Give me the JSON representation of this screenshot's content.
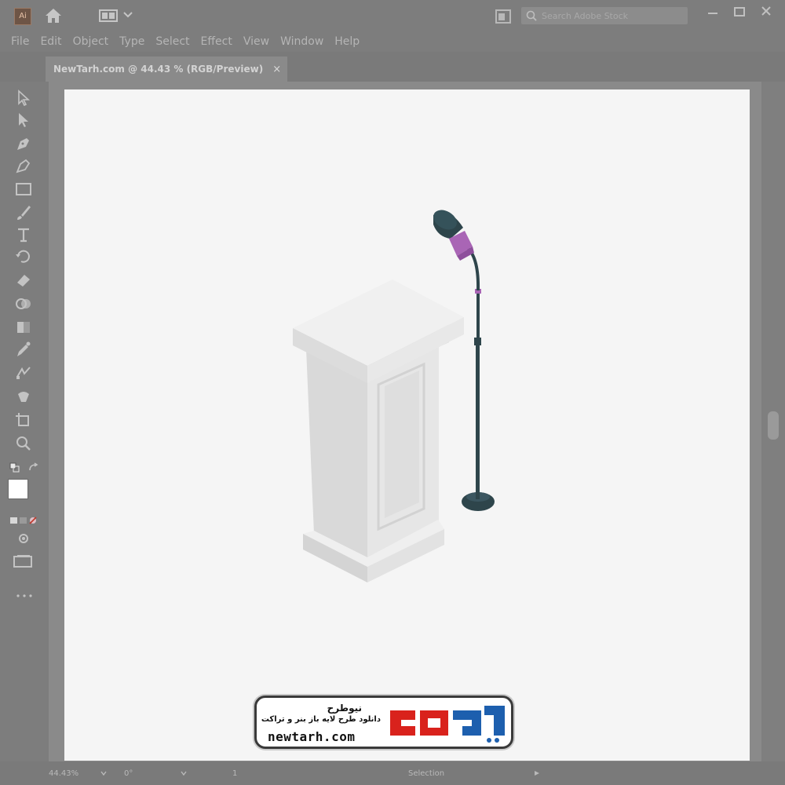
{
  "app": {
    "logo_text": "Ai",
    "search_placeholder": "Search Adobe Stock"
  },
  "menu": {
    "items": [
      "File",
      "Edit",
      "Object",
      "Type",
      "Select",
      "Effect",
      "View",
      "Window",
      "Help"
    ]
  },
  "document_tab": {
    "label": "NewTarh.com @ 44.43 % (RGB/Preview)",
    "close": "×"
  },
  "status": {
    "zoom": "44.43%",
    "rotate": "0°",
    "artboard": "1",
    "mode": "Selection"
  },
  "watermark": {
    "brand_fa": "نیوطرح",
    "tagline_fa": "دانلود طرح لایه باز بنر و تراکت",
    "url": "newtarh.com",
    "logo_text_fa": "نیوطرح"
  },
  "colors": {
    "chrome": "#7d7d7d",
    "canvas": "#8a8a8a",
    "artboard": "#f5f5f5",
    "mic_body": "#2e454b",
    "mic_accent": "#a965b5",
    "logo_red": "#d9221c",
    "logo_blue": "#1d5fae"
  },
  "icons": {
    "tools": [
      "selection-tool-icon",
      "direct-selection-tool-icon",
      "pen-tool-icon",
      "curvature-tool-icon",
      "rectangle-tool-icon",
      "paintbrush-tool-icon",
      "type-tool-icon",
      "rotate-tool-icon",
      "eraser-tool-icon",
      "shape-builder-tool-icon",
      "gradient-tool-icon",
      "eyedropper-tool-icon",
      "blend-tool-icon",
      "symbol-sprayer-tool-icon",
      "artboard-tool-icon",
      "zoom-tool-icon"
    ]
  }
}
